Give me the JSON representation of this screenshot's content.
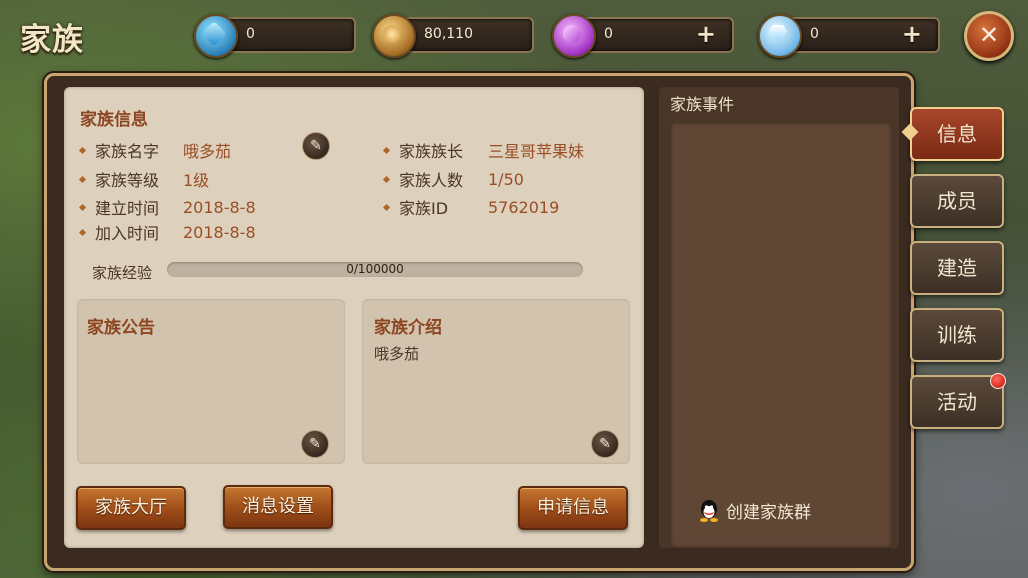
{
  "title": "家族",
  "resources": [
    {
      "icon": "blue-gem-icon",
      "value": "0",
      "has_plus": false
    },
    {
      "icon": "gold-coin-icon",
      "value": "80,110",
      "has_plus": false
    },
    {
      "icon": "purple-gem-icon",
      "value": "0",
      "has_plus": true
    },
    {
      "icon": "diamond-icon",
      "value": "0",
      "has_plus": true
    }
  ],
  "plus_symbol": "+",
  "close_symbol": "✕",
  "family_info": {
    "title": "家族信息",
    "name_label": "家族名字",
    "name_value": "哦多茄",
    "level_label": "家族等级",
    "level_value": "1级",
    "created_label": "建立时间",
    "created_value": "2018-8-8",
    "joined_label": "加入时间",
    "joined_value": "2018-8-8",
    "leader_label": "家族族长",
    "leader_value": "三星哥苹果妹",
    "members_label": "家族人数",
    "members_value": "1/50",
    "id_label": "家族ID",
    "id_value": "5762019",
    "exp_label": "家族经验",
    "exp_text": "0/100000",
    "exp_fraction": 0
  },
  "announcement": {
    "title": "家族公告",
    "text": ""
  },
  "introduction": {
    "title": "家族介绍",
    "text": "哦多茄"
  },
  "buttons": {
    "hall": "家族大厅",
    "message_settings": "消息设置",
    "applications": "申请信息"
  },
  "events": {
    "title": "家族事件",
    "create_group": "创建家族群"
  },
  "tabs": [
    {
      "label": "信息",
      "active": true,
      "notify": false
    },
    {
      "label": "成员",
      "active": false,
      "notify": false
    },
    {
      "label": "建造",
      "active": false,
      "notify": false
    },
    {
      "label": "训练",
      "active": false,
      "notify": false
    },
    {
      "label": "活动",
      "active": false,
      "notify": true
    }
  ],
  "colors": {
    "accent": "#8c4722",
    "active_tab": "#a8462a",
    "button": "#9e4c18"
  }
}
